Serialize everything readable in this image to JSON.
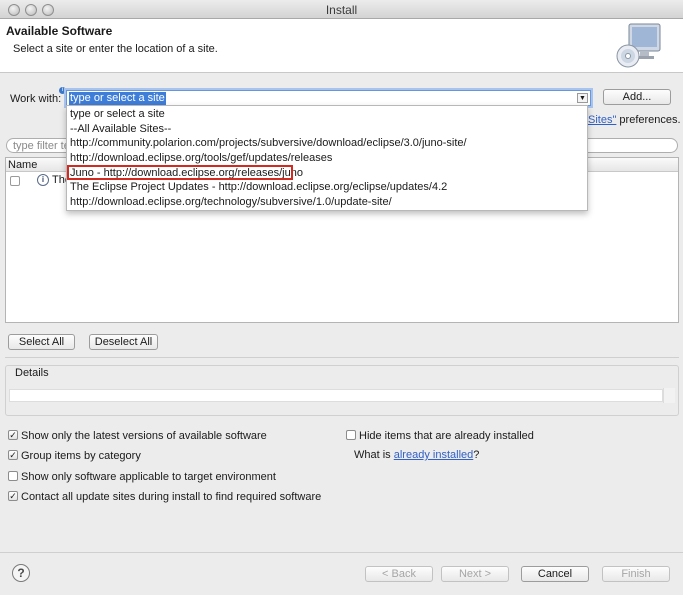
{
  "window": {
    "title": "Install"
  },
  "header": {
    "title": "Available Software",
    "subtitle": "Select a site or enter the location of a site.",
    "icon": "install-cd-monitor-icon"
  },
  "work_with": {
    "label": "Work with:",
    "value": "type or select a site",
    "add_label": "Add...",
    "pref_link": "Sites\"",
    "pref_suffix": "preferences."
  },
  "dropdown": {
    "items": [
      "type or select a site",
      "--All Available Sites--",
      "http://community.polarion.com/projects/subversive/download/eclipse/3.0/juno-site/",
      "http://download.eclipse.org/tools/gef/updates/releases",
      "Juno - http://download.eclipse.org/releases/juno",
      "The Eclipse Project Updates - http://download.eclipse.org/eclipse/updates/4.2",
      "http://download.eclipse.org/technology/subversive/1.0/update-site/"
    ],
    "highlighted_index": 4,
    "highlight_color": "#d22a20"
  },
  "filter": {
    "placeholder": "type filter te"
  },
  "table": {
    "columns": [
      "Name"
    ],
    "rows": [
      {
        "text": "The"
      }
    ]
  },
  "buttons": {
    "select_all": "Select All",
    "deselect_all": "Deselect All",
    "back": "< Back",
    "next": "Next >",
    "cancel": "Cancel",
    "finish": "Finish"
  },
  "details": {
    "label": "Details"
  },
  "options": {
    "latest_versions": {
      "label": "Show only the latest versions of available software",
      "checked": true
    },
    "group_by_category": {
      "label": "Group items by category",
      "checked": true
    },
    "target_env": {
      "label": "Show only software applicable to target environment",
      "checked": false
    },
    "contact_sites": {
      "label": "Contact all update sites during install to find required software",
      "checked": true
    },
    "hide_installed": {
      "label": "Hide items that are already installed",
      "checked": false
    },
    "what_is_prefix": "What is",
    "already_installed_link": "already installed",
    "what_is_suffix": "?"
  },
  "colors": {
    "accent": "#3e7dd8",
    "link": "#2f5fc7"
  }
}
